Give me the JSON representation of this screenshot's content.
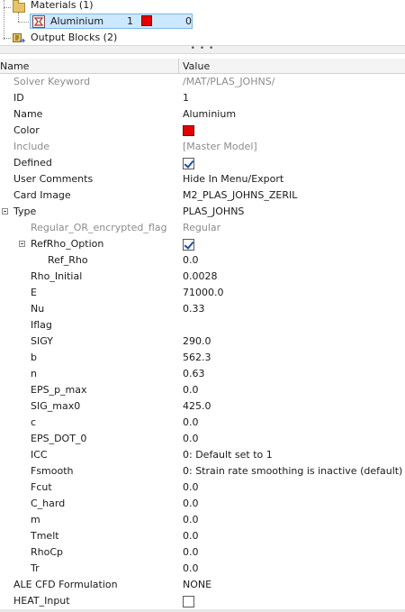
{
  "tree": {
    "materials_label": "Materials (1)",
    "material_item": {
      "name": "Aluminium",
      "id": "1",
      "count": "0",
      "color": "#e50000"
    },
    "output_blocks_label": "Output Blocks (2)"
  },
  "splitter": {
    "label": "• • •"
  },
  "table": {
    "header_name": "Name",
    "header_value": "Value",
    "rows": [
      {
        "name": "Solver Keyword",
        "value": "/MAT/PLAS_JOHNS/",
        "indent": 0,
        "disabled": true,
        "kind": "text"
      },
      {
        "name": "ID",
        "value": "1",
        "indent": 0,
        "disabled": false,
        "kind": "text"
      },
      {
        "name": "Name",
        "value": "Aluminium",
        "indent": 0,
        "disabled": false,
        "kind": "text"
      },
      {
        "name": "Color",
        "value": "#e50000",
        "indent": 0,
        "disabled": false,
        "kind": "color"
      },
      {
        "name": "Include",
        "value": "[Master Model]",
        "indent": 0,
        "disabled": true,
        "kind": "text"
      },
      {
        "name": "Defined",
        "value": "",
        "indent": 0,
        "disabled": false,
        "kind": "checkbox",
        "checked": true
      },
      {
        "name": "User Comments",
        "value": "Hide In Menu/Export",
        "indent": 0,
        "disabled": false,
        "kind": "text"
      },
      {
        "name": "Card Image",
        "value": "M2_PLAS_JOHNS_ZERIL",
        "indent": 0,
        "disabled": false,
        "kind": "text"
      },
      {
        "name": "Type",
        "value": "PLAS_JOHNS",
        "indent": 0,
        "disabled": false,
        "kind": "text",
        "expander": true
      },
      {
        "name": "Regular_OR_encrypted_flag",
        "value": "Regular",
        "indent": 1,
        "disabled": true,
        "kind": "text"
      },
      {
        "name": "RefRho_Option",
        "value": "",
        "indent": 1,
        "disabled": false,
        "kind": "checkbox",
        "checked": true,
        "expander": true
      },
      {
        "name": "Ref_Rho",
        "value": "0.0",
        "indent": 2,
        "disabled": false,
        "kind": "text"
      },
      {
        "name": "Rho_Initial",
        "value": "0.0028",
        "indent": 1,
        "disabled": false,
        "kind": "text"
      },
      {
        "name": "E",
        "value": "71000.0",
        "indent": 1,
        "disabled": false,
        "kind": "text"
      },
      {
        "name": "Nu",
        "value": "0.33",
        "indent": 1,
        "disabled": false,
        "kind": "text"
      },
      {
        "name": "Iflag",
        "value": "",
        "indent": 1,
        "disabled": false,
        "kind": "text"
      },
      {
        "name": "SIGY",
        "value": "290.0",
        "indent": 1,
        "disabled": false,
        "kind": "text"
      },
      {
        "name": "b",
        "value": "562.3",
        "indent": 1,
        "disabled": false,
        "kind": "text"
      },
      {
        "name": "n",
        "value": "0.63",
        "indent": 1,
        "disabled": false,
        "kind": "text"
      },
      {
        "name": "EPS_p_max",
        "value": "0.0",
        "indent": 1,
        "disabled": false,
        "kind": "text"
      },
      {
        "name": "SIG_max0",
        "value": "425.0",
        "indent": 1,
        "disabled": false,
        "kind": "text"
      },
      {
        "name": "c",
        "value": "0.0",
        "indent": 1,
        "disabled": false,
        "kind": "text"
      },
      {
        "name": "EPS_DOT_0",
        "value": "0.0",
        "indent": 1,
        "disabled": false,
        "kind": "text"
      },
      {
        "name": "ICC",
        "value": "0: Default set to 1",
        "indent": 1,
        "disabled": false,
        "kind": "text"
      },
      {
        "name": "Fsmooth",
        "value": "0: Strain rate smoothing is inactive (default)",
        "indent": 1,
        "disabled": false,
        "kind": "text"
      },
      {
        "name": "Fcut",
        "value": "0.0",
        "indent": 1,
        "disabled": false,
        "kind": "text"
      },
      {
        "name": "C_hard",
        "value": "0.0",
        "indent": 1,
        "disabled": false,
        "kind": "text"
      },
      {
        "name": "m",
        "value": "0.0",
        "indent": 1,
        "disabled": false,
        "kind": "text"
      },
      {
        "name": "Tmelt",
        "value": "0.0",
        "indent": 1,
        "disabled": false,
        "kind": "text"
      },
      {
        "name": "RhoCp",
        "value": "0.0",
        "indent": 1,
        "disabled": false,
        "kind": "text"
      },
      {
        "name": "Tr",
        "value": "0.0",
        "indent": 1,
        "disabled": false,
        "kind": "text"
      },
      {
        "name": "ALE CFD Formulation",
        "value": "NONE",
        "indent": 0,
        "disabled": false,
        "kind": "text"
      },
      {
        "name": "HEAT_Input",
        "value": "",
        "indent": 0,
        "disabled": false,
        "kind": "checkbox",
        "checked": false
      }
    ]
  }
}
